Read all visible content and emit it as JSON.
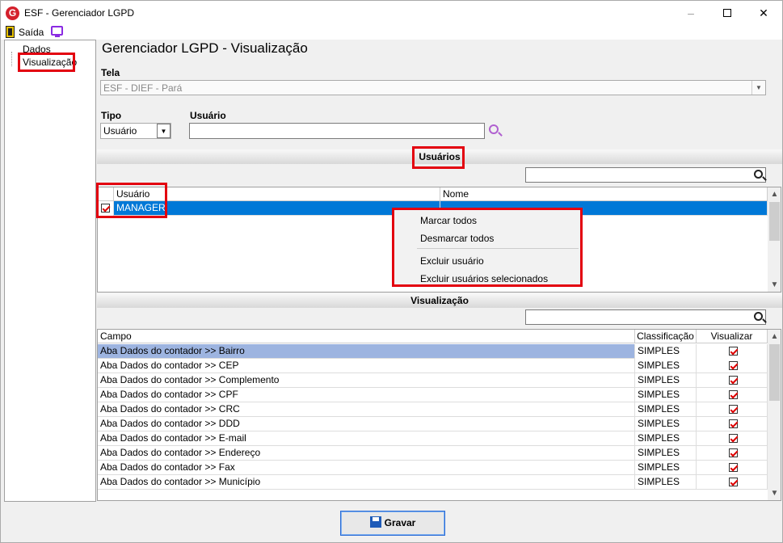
{
  "window": {
    "title": "ESF - Gerenciador LGPD",
    "app_icon": "G",
    "min": "–",
    "close": "✕"
  },
  "menubar": {
    "exit_label": "Saída"
  },
  "tree": {
    "items": [
      "Dados",
      "Visualização"
    ]
  },
  "page": {
    "title": "Gerenciador LGPD - Visualização"
  },
  "tela": {
    "label": "Tela",
    "value": "ESF - DIEF - Pará"
  },
  "tipo": {
    "label": "Tipo",
    "value": "Usuário"
  },
  "usuario_field": {
    "label": "Usuário",
    "value": ""
  },
  "usuarios_section": {
    "title": "Usuários",
    "columns": [
      "Usuário",
      "Nome"
    ],
    "rows": [
      {
        "usuario": "MANAGER",
        "nome": "",
        "checked": true
      }
    ]
  },
  "context_menu": {
    "items": [
      "Marcar todos",
      "Desmarcar todos",
      "Excluir usuário",
      "Excluir usuários selecionados"
    ]
  },
  "visualizacao_section": {
    "title": "Visualização",
    "columns": [
      "Campo",
      "Classificação",
      "Visualizar"
    ],
    "rows": [
      {
        "campo": "Aba Dados do contador >> Bairro",
        "classificacao": "SIMPLES",
        "visualizar": true
      },
      {
        "campo": "Aba Dados do contador >> CEP",
        "classificacao": "SIMPLES",
        "visualizar": true
      },
      {
        "campo": "Aba Dados do contador >> Complemento",
        "classificacao": "SIMPLES",
        "visualizar": true
      },
      {
        "campo": "Aba Dados do contador >> CPF",
        "classificacao": "SIMPLES",
        "visualizar": true
      },
      {
        "campo": "Aba Dados do contador >> CRC",
        "classificacao": "SIMPLES",
        "visualizar": true
      },
      {
        "campo": "Aba Dados do contador >> DDD",
        "classificacao": "SIMPLES",
        "visualizar": true
      },
      {
        "campo": "Aba Dados do contador >> E-mail",
        "classificacao": "SIMPLES",
        "visualizar": true
      },
      {
        "campo": "Aba Dados do contador >> Endereço",
        "classificacao": "SIMPLES",
        "visualizar": true
      },
      {
        "campo": "Aba Dados do contador >> Fax",
        "classificacao": "SIMPLES",
        "visualizar": true
      },
      {
        "campo": "Aba Dados do contador >> Município",
        "classificacao": "SIMPLES",
        "visualizar": true
      }
    ]
  },
  "footer": {
    "save_label": "Gravar"
  },
  "colors": {
    "highlight": "#e3000f",
    "selection": "#0078d7",
    "row_select": "#9db4e0"
  }
}
